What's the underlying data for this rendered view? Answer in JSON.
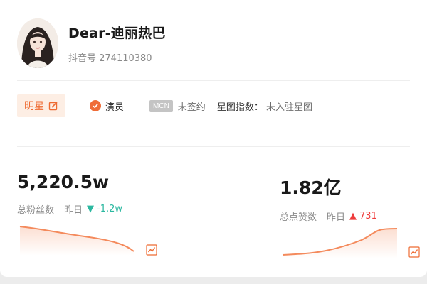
{
  "profile": {
    "name": "Dear-迪丽热巴",
    "douyin_id": "抖音号 274110380"
  },
  "tags": {
    "category": "明星",
    "role": "演员",
    "mcn_badge": "MCN",
    "mcn_status": "未签约",
    "xingtu_label": "星图指数：",
    "xingtu_value": "未入驻星图"
  },
  "stats": {
    "followers": {
      "value": "5,220.5w",
      "label": "总粉丝数",
      "yesterday_label": "昨日",
      "change_arrow": "▼",
      "change": "-1.2w",
      "trend": "down"
    },
    "likes": {
      "value": "1.82亿",
      "label": "总点赞数",
      "yesterday_label": "昨日",
      "change_arrow": "▲",
      "change": "731",
      "trend": "up"
    }
  },
  "colors": {
    "accent": "#ee6b32",
    "down": "#2bb8a0",
    "up": "#ee3c3c",
    "spark": "#f48a5c"
  },
  "icons": {
    "edit": "edit-icon",
    "check": "check-circle-icon",
    "trend": "trend-chart-icon"
  }
}
